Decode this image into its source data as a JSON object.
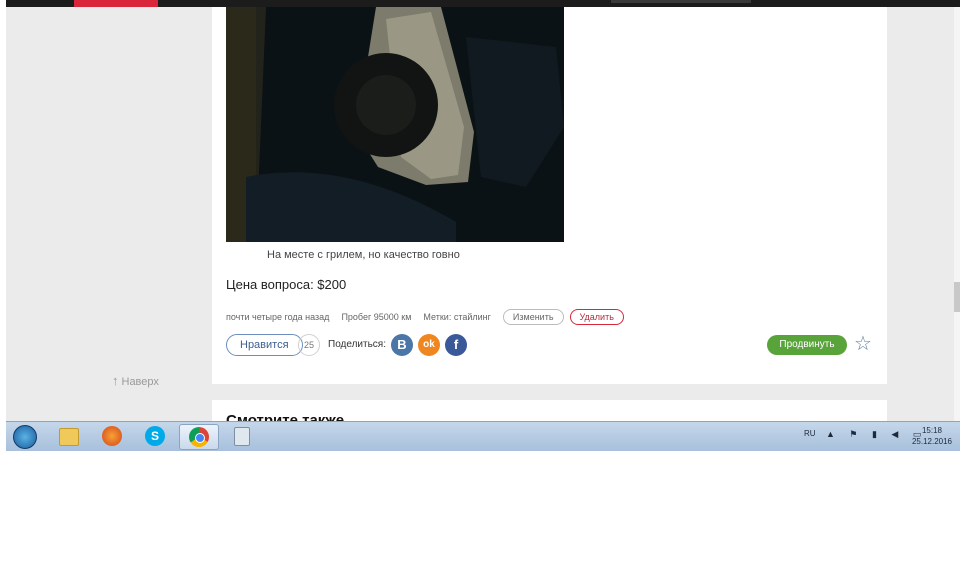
{
  "post": {
    "caption": "На месте с грилем, но качество говно",
    "price": "Цена вопроса: $200",
    "meta": {
      "age": "почти четыре года назад",
      "mileage": "Пробег 95000 км",
      "tags": "Метки: стайлинг",
      "edit_label": "Изменить",
      "delete_label": "Удалить"
    },
    "actions": {
      "like_label": "Нравится",
      "like_count": "25",
      "share_label": "Поделиться:",
      "vk_letter": "В",
      "ok_letter": "ok",
      "fb_letter": "f",
      "promote_label": "Продвинуть",
      "star_glyph": "☆"
    }
  },
  "sidebar": {
    "back_to_top": "Наверх",
    "back_to_top_icon": "↑"
  },
  "see_also": {
    "title": "Смотрите также"
  },
  "taskbar": {
    "apps": [
      "start-button",
      "explorer",
      "firefox",
      "skype",
      "chrome",
      "calculator"
    ],
    "skype_letter": "S",
    "language": "RU",
    "tray_icons": "▲ ⚑ ▮ ◀ ▭",
    "time": "15:18",
    "date": "25.12.2016"
  },
  "colors": {
    "accent_red": "#d9263a",
    "promote_green": "#58a33a",
    "vk_blue": "#4a76a8",
    "ok_orange": "#f0861f",
    "fb_blue": "#3b5998"
  }
}
